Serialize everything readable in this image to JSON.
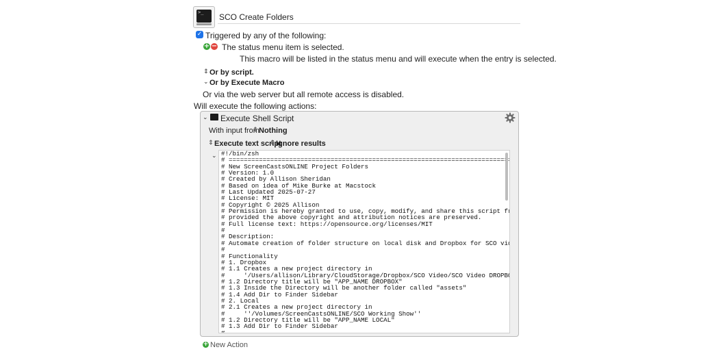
{
  "macro": {
    "name": "SCO Create Folders",
    "icon": "terminal-icon"
  },
  "trigger": {
    "checkbox_checked": true,
    "label": "Triggered by any of the following:",
    "status_item_text": "The status menu item is selected.",
    "status_item_desc": "This macro will be listed in the status menu and will execute when the entry is selected.",
    "or_by_script": "Or by script.",
    "or_by_execute_macro": "Or by Execute Macro",
    "web_server_text": "Or via the web server but all remote access is disabled."
  },
  "actions": {
    "label": "Will execute the following actions:",
    "new_action_label": "New Action",
    "shell": {
      "title": "Execute Shell Script",
      "input_label": "With input from",
      "input_value": "Nothing",
      "mode_value": "Execute text script",
      "results_value": "Ignore results",
      "script": "#!/bin/zsh\n# ===========================================================================\n# New ScreenCastsONLINE Project Folders\n# Version: 1.0\n# Created by Allison Sheridan\n# Based on idea of Mike Burke at Macstock\n# Last Updated 2025-07-27\n# License: MIT\n# Copyright © 2025 Allison\n# Permission is hereby granted to use, copy, modify, and share this script freely,\n# provided the above copyright and attribution notices are preserved.\n# Full license text: https://opensource.org/licenses/MIT\n#\n# Description:\n# Automate creation of folder structure on local disk and Dropbox for SCO videos\n#\n# Functionality\n# 1. Dropbox\n# 1.1 Creates a new project directory in\n#     '/Users/allison/Library/CloudStorage/Dropbox/SCO Video/SCO Video DROPBOX'\n# 1.2 Directory title will be \"APP_NAME DROPBOX\"\n# 1.3 Inside the Directory will be another folder called \"assets\"\n# 1.4 Add Dir to Finder Sidebar\n# 2. Local\n# 2.1 Creates a new project directory in\n#     ''/Volumes/ScreenCastsONLINE/SCO Working Show''\n# 1.2 Directory title will be \"APP_NAME LOCAL\"\n# 1.3 Add Dir to Finder Sidebar\n#"
    }
  },
  "colors": {
    "accent": "#1e73e8",
    "add": "#3aa53a",
    "remove": "#e0463f"
  }
}
